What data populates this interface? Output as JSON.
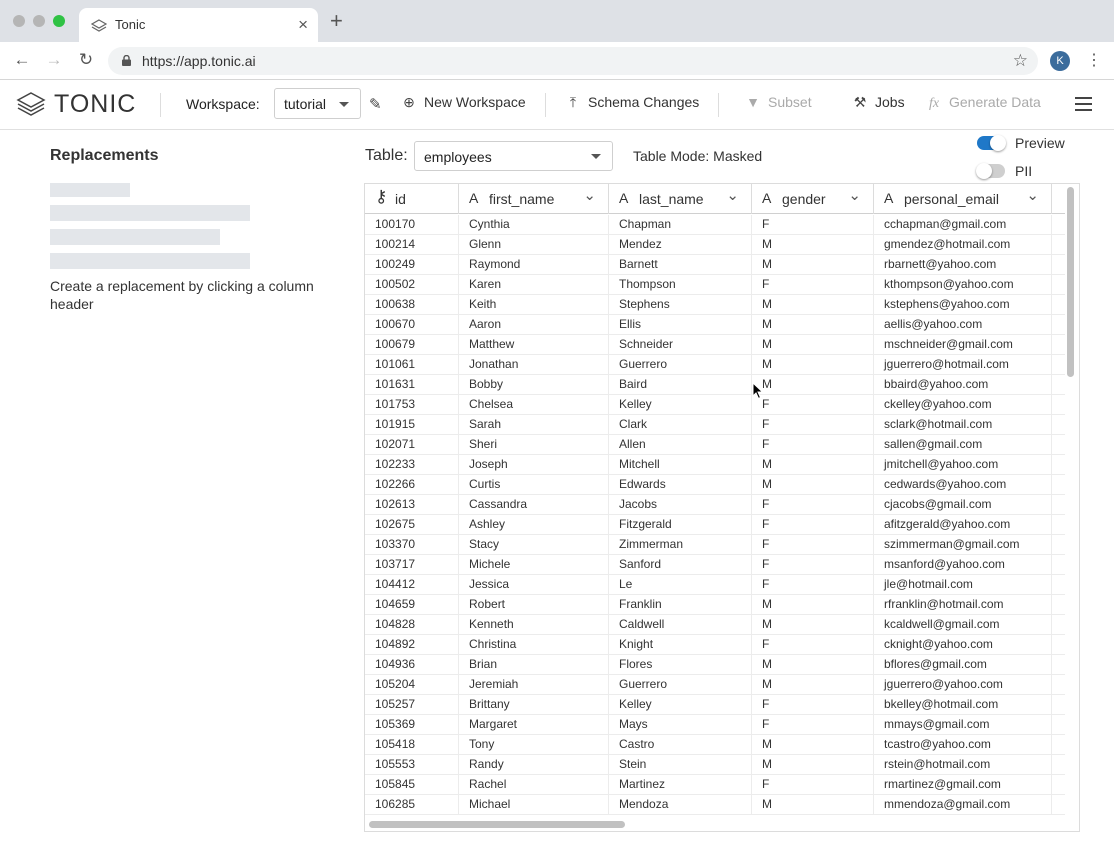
{
  "browser": {
    "tab_title": "Tonic",
    "url": "https://app.tonic.ai",
    "profile_initial": "K"
  },
  "header": {
    "logo_text": "TONIC",
    "workspace_label": "Workspace:",
    "workspace_value": "tutorial",
    "new_workspace": "New Workspace",
    "schema_changes": "Schema Changes",
    "subset": "Subset",
    "jobs": "Jobs",
    "generate_data": "Generate Data"
  },
  "left_panel": {
    "title": "Replacements",
    "hint": "Create a replacement by clicking a column header"
  },
  "table_controls": {
    "table_label": "Table:",
    "table_value": "employees",
    "table_mode": "Table Mode: Masked",
    "preview_label": "Preview",
    "preview_on": true,
    "pii_label": "PII",
    "pii_on": false
  },
  "colors": {
    "accent": "#1f78c8",
    "toggle_off": "#cfcfcf"
  },
  "grid": {
    "columns": [
      {
        "name": "id",
        "icon": "key-icon"
      },
      {
        "name": "first_name",
        "icon": "text-type-icon"
      },
      {
        "name": "last_name",
        "icon": "text-type-icon"
      },
      {
        "name": "gender",
        "icon": "text-type-icon"
      },
      {
        "name": "personal_email",
        "icon": "text-type-icon"
      }
    ],
    "rows": [
      [
        "100170",
        "Cynthia",
        "Chapman",
        "F",
        "cchapman@gmail.com"
      ],
      [
        "100214",
        "Glenn",
        "Mendez",
        "M",
        "gmendez@hotmail.com"
      ],
      [
        "100249",
        "Raymond",
        "Barnett",
        "M",
        "rbarnett@yahoo.com"
      ],
      [
        "100502",
        "Karen",
        "Thompson",
        "F",
        "kthompson@yahoo.com"
      ],
      [
        "100638",
        "Keith",
        "Stephens",
        "M",
        "kstephens@yahoo.com"
      ],
      [
        "100670",
        "Aaron",
        "Ellis",
        "M",
        "aellis@yahoo.com"
      ],
      [
        "100679",
        "Matthew",
        "Schneider",
        "M",
        "mschneider@gmail.com"
      ],
      [
        "101061",
        "Jonathan",
        "Guerrero",
        "M",
        "jguerrero@hotmail.com"
      ],
      [
        "101631",
        "Bobby",
        "Baird",
        "M",
        "bbaird@yahoo.com"
      ],
      [
        "101753",
        "Chelsea",
        "Kelley",
        "F",
        "ckelley@yahoo.com"
      ],
      [
        "101915",
        "Sarah",
        "Clark",
        "F",
        "sclark@hotmail.com"
      ],
      [
        "102071",
        "Sheri",
        "Allen",
        "F",
        "sallen@gmail.com"
      ],
      [
        "102233",
        "Joseph",
        "Mitchell",
        "M",
        "jmitchell@yahoo.com"
      ],
      [
        "102266",
        "Curtis",
        "Edwards",
        "M",
        "cedwards@yahoo.com"
      ],
      [
        "102613",
        "Cassandra",
        "Jacobs",
        "F",
        "cjacobs@gmail.com"
      ],
      [
        "102675",
        "Ashley",
        "Fitzgerald",
        "F",
        "afitzgerald@yahoo.com"
      ],
      [
        "103370",
        "Stacy",
        "Zimmerman",
        "F",
        "szimmerman@gmail.com"
      ],
      [
        "103717",
        "Michele",
        "Sanford",
        "F",
        "msanford@yahoo.com"
      ],
      [
        "104412",
        "Jessica",
        "Le",
        "F",
        "jle@hotmail.com"
      ],
      [
        "104659",
        "Robert",
        "Franklin",
        "M",
        "rfranklin@hotmail.com"
      ],
      [
        "104828",
        "Kenneth",
        "Caldwell",
        "M",
        "kcaldwell@gmail.com"
      ],
      [
        "104892",
        "Christina",
        "Knight",
        "F",
        "cknight@yahoo.com"
      ],
      [
        "104936",
        "Brian",
        "Flores",
        "M",
        "bflores@gmail.com"
      ],
      [
        "105204",
        "Jeremiah",
        "Guerrero",
        "M",
        "jguerrero@yahoo.com"
      ],
      [
        "105257",
        "Brittany",
        "Kelley",
        "F",
        "bkelley@hotmail.com"
      ],
      [
        "105369",
        "Margaret",
        "Mays",
        "F",
        "mmays@gmail.com"
      ],
      [
        "105418",
        "Tony",
        "Castro",
        "M",
        "tcastro@yahoo.com"
      ],
      [
        "105553",
        "Randy",
        "Stein",
        "M",
        "rstein@hotmail.com"
      ],
      [
        "105845",
        "Rachel",
        "Martinez",
        "F",
        "rmartinez@gmail.com"
      ],
      [
        "106285",
        "Michael",
        "Mendoza",
        "M",
        "mmendoza@gmail.com"
      ]
    ]
  }
}
